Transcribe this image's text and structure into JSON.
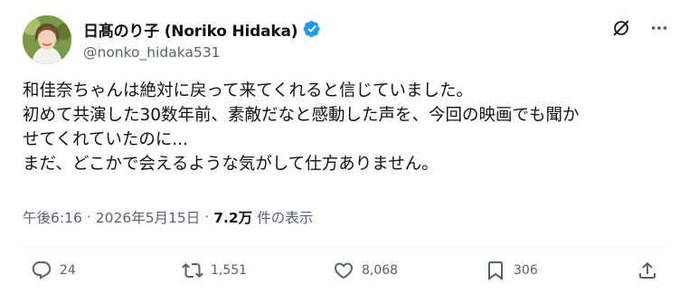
{
  "author": {
    "display_name": "日髙のり子 (Noriko Hidaka)",
    "handle": "@nonko_hidaka531",
    "verified": true
  },
  "body_lines": [
    "和佳奈ちゃんは絶対に戻って来てくれると信じていました。",
    "初めて共演した30数年前、素敵だなと感動した声を、今回の映画でも聞か",
    "せてくれていたのに...",
    "まだ、どこかで会えるような気がして仕方ありません。"
  ],
  "meta": {
    "time": "午後6:16",
    "date": "2026年5月15日",
    "separator": "·",
    "views_count": "7.2万",
    "views_label": "件の表示"
  },
  "actions": {
    "replies": "24",
    "retweets": "1,551",
    "likes": "8,068",
    "bookmarks": "306"
  },
  "icons": {
    "top_right": [
      "grok-icon",
      "more-icon"
    ],
    "action_bar": [
      "reply-icon",
      "retweet-icon",
      "like-icon",
      "bookmark-icon",
      "share-icon"
    ]
  },
  "colors": {
    "verified_badge": "#1d9bf0",
    "text_primary": "#0f1419",
    "text_secondary": "#536471"
  }
}
